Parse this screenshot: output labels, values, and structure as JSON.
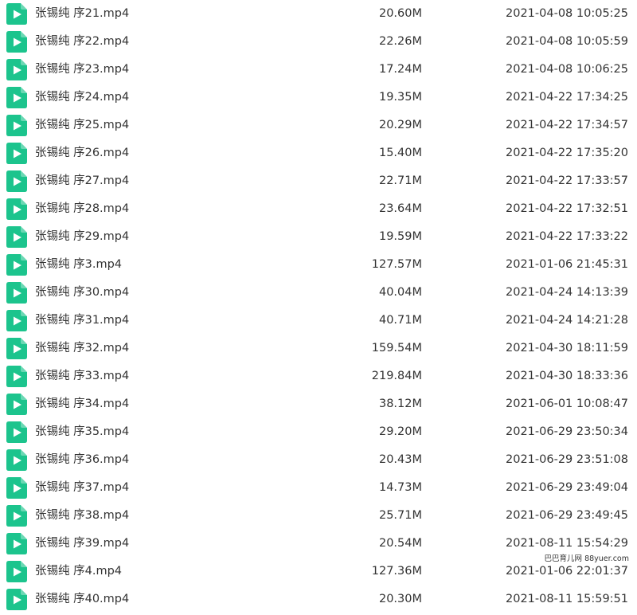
{
  "icon_color": "#1cc48d",
  "icon_name": "video-file-icon",
  "files": [
    {
      "name": "张锡纯 序21.mp4",
      "size": "20.60M",
      "date": "2021-04-08 10:05:25"
    },
    {
      "name": "张锡纯 序22.mp4",
      "size": "22.26M",
      "date": "2021-04-08 10:05:59"
    },
    {
      "name": "张锡纯 序23.mp4",
      "size": "17.24M",
      "date": "2021-04-08 10:06:25"
    },
    {
      "name": "张锡纯 序24.mp4",
      "size": "19.35M",
      "date": "2021-04-22 17:34:25"
    },
    {
      "name": "张锡纯 序25.mp4",
      "size": "20.29M",
      "date": "2021-04-22 17:34:57"
    },
    {
      "name": "张锡纯 序26.mp4",
      "size": "15.40M",
      "date": "2021-04-22 17:35:20"
    },
    {
      "name": "张锡纯 序27.mp4",
      "size": "22.71M",
      "date": "2021-04-22 17:33:57"
    },
    {
      "name": "张锡纯 序28.mp4",
      "size": "23.64M",
      "date": "2021-04-22 17:32:51"
    },
    {
      "name": "张锡纯 序29.mp4",
      "size": "19.59M",
      "date": "2021-04-22 17:33:22"
    },
    {
      "name": "张锡纯 序3.mp4",
      "size": "127.57M",
      "date": "2021-01-06 21:45:31"
    },
    {
      "name": "张锡纯 序30.mp4",
      "size": "40.04M",
      "date": "2021-04-24 14:13:39"
    },
    {
      "name": "张锡纯 序31.mp4",
      "size": "40.71M",
      "date": "2021-04-24 14:21:28"
    },
    {
      "name": "张锡纯 序32.mp4",
      "size": "159.54M",
      "date": "2021-04-30 18:11:59"
    },
    {
      "name": "张锡纯 序33.mp4",
      "size": "219.84M",
      "date": "2021-04-30 18:33:36"
    },
    {
      "name": "张锡纯 序34.mp4",
      "size": "38.12M",
      "date": "2021-06-01 10:08:47"
    },
    {
      "name": "张锡纯 序35.mp4",
      "size": "29.20M",
      "date": "2021-06-29 23:50:34"
    },
    {
      "name": "张锡纯 序36.mp4",
      "size": "20.43M",
      "date": "2021-06-29 23:51:08"
    },
    {
      "name": "张锡纯 序37.mp4",
      "size": "14.73M",
      "date": "2021-06-29 23:49:04"
    },
    {
      "name": "张锡纯 序38.mp4",
      "size": "25.71M",
      "date": "2021-06-29 23:49:45"
    },
    {
      "name": "张锡纯 序39.mp4",
      "size": "20.54M",
      "date": "2021-08-11 15:54:29"
    },
    {
      "name": "张锡纯 序4.mp4",
      "size": "127.36M",
      "date": "2021-01-06 22:01:37"
    },
    {
      "name": "张锡纯 序40.mp4",
      "size": "20.30M",
      "date": "2021-08-11 15:59:51"
    }
  ],
  "watermark": "巴巴育儿网 88yuer.com"
}
